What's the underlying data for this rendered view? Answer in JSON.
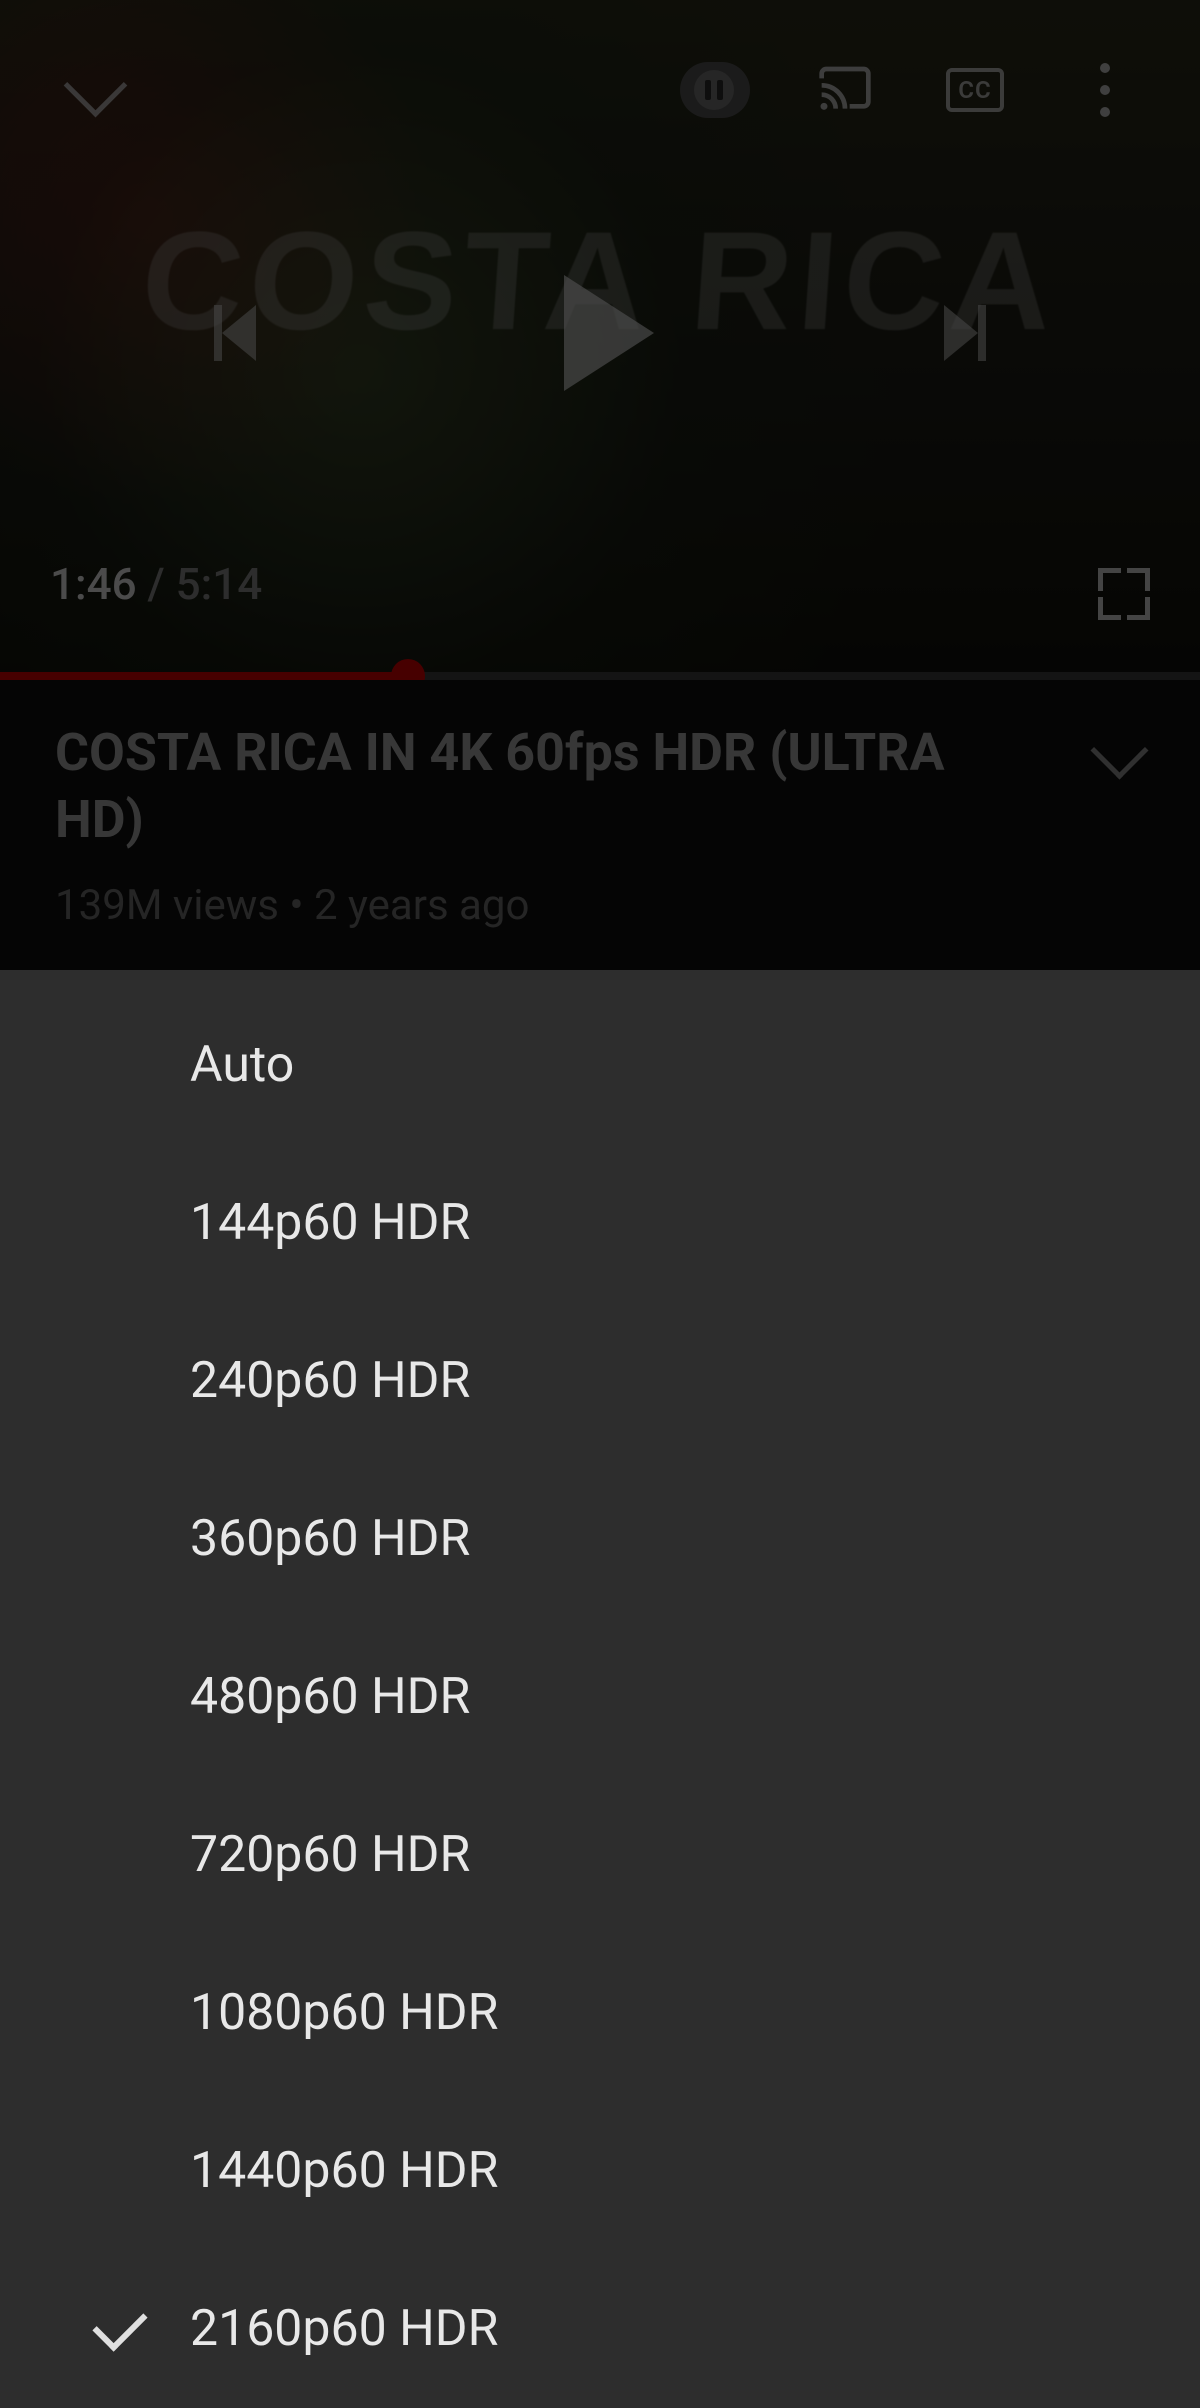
{
  "player": {
    "overlay_text": "COSTA RICA",
    "elapsed": "1:46",
    "separator": " / ",
    "total": "5:14",
    "progress_percent": 34,
    "cc_label": "CC"
  },
  "video": {
    "title": "COSTA RICA IN 4K 60fps HDR (ULTRA HD)",
    "meta": "139M views • 2 years ago"
  },
  "quality_menu": {
    "selected_index": 8,
    "items": [
      {
        "label": "Auto"
      },
      {
        "label": "144p60 HDR"
      },
      {
        "label": "240p60 HDR"
      },
      {
        "label": "360p60 HDR"
      },
      {
        "label": "480p60 HDR"
      },
      {
        "label": "720p60 HDR"
      },
      {
        "label": "1080p60 HDR"
      },
      {
        "label": "1440p60 HDR"
      },
      {
        "label": "2160p60 HDR"
      }
    ]
  }
}
